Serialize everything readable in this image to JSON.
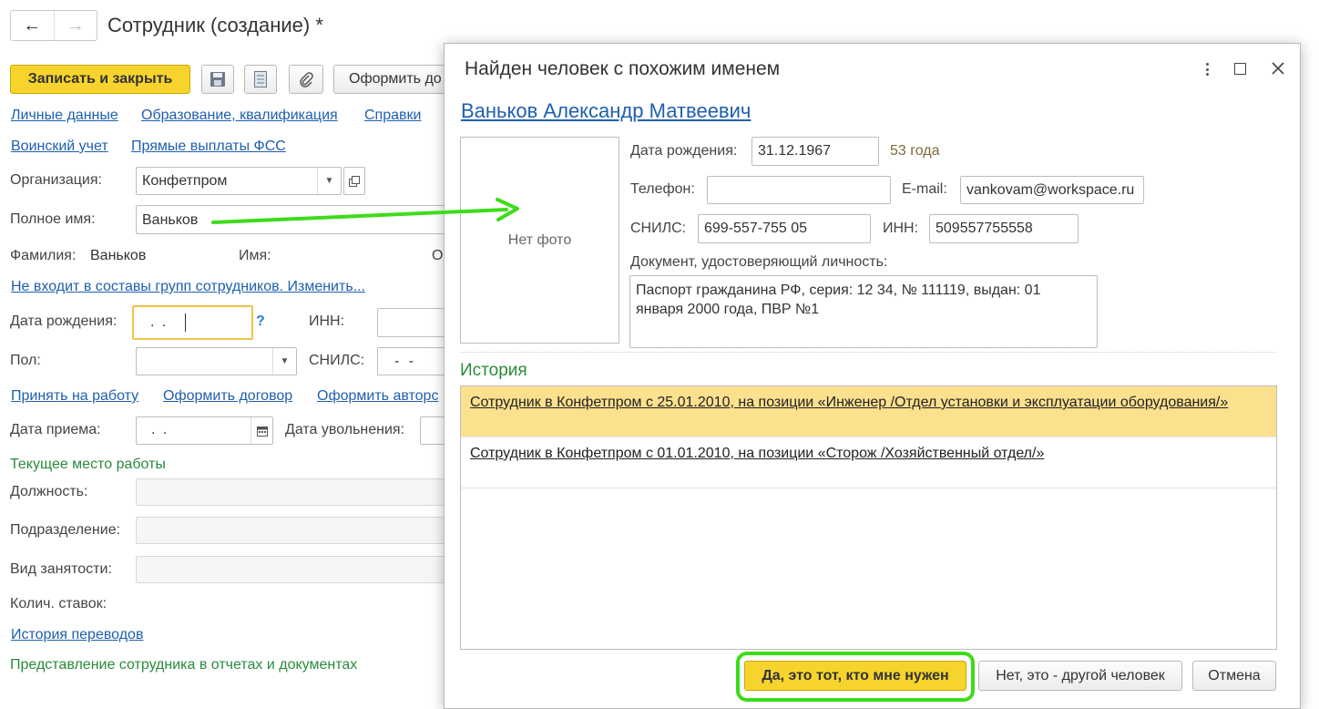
{
  "window": {
    "title": "Сотрудник (создание) *"
  },
  "toolbar": {
    "save_close": "Записать и закрыть",
    "oformit": "Оформить до"
  },
  "links_row1": [
    "Личные данные",
    "Образование, квалификация",
    "Справки"
  ],
  "links_row2": [
    "Воинский учет",
    "Прямые выплаты ФСС"
  ],
  "form": {
    "org_label": "Организация:",
    "org_value": "Конфетпром",
    "fullname_label": "Полное имя:",
    "fullname_value": "Ваньков",
    "surname_label": "Фамилия:",
    "surname_value": "Ваньков",
    "name_label": "Имя:",
    "otch_label": "О",
    "groups_link": "Не входит в составы групп сотрудников. Изменить...",
    "birth_label": "Дата рождения:",
    "birth_value": ".  .",
    "help": "?",
    "inn_label": "ИНН:",
    "sex_label": "Пол:",
    "snils_label": "СНИЛС:",
    "snils_value": "-  -",
    "hire_links": [
      "Принять на работу",
      "Оформить договор",
      "Оформить авторс"
    ],
    "hire_date_label": "Дата приема:",
    "hire_date_value": ".  .",
    "fire_date_label": "Дата увольнения:",
    "current_work": "Текущее место работы",
    "position_label": "Должность:",
    "dept_label": "Подразделение:",
    "employment_label": "Вид занятости:",
    "rates_label": "Колич. ставок:",
    "history_link": "История переводов",
    "presentation": "Представление сотрудника в отчетах и документах"
  },
  "dialog": {
    "title": "Найден человек с похожим именем",
    "person_name": "Ваньков Александр Матвеевич",
    "no_photo": "Нет фото",
    "birth_label": "Дата рождения:",
    "birth_value": "31.12.1967",
    "age": "53 года",
    "phone_label": "Телефон:",
    "phone_value": "",
    "email_label": "E-mail:",
    "email_value": "vankovam@workspace.ru",
    "snils_label": "СНИЛС:",
    "snils_value": "699-557-755 05",
    "inn_label": "ИНН:",
    "inn_value": "509557755558",
    "doc_label": "Документ, удостоверяющий личность:",
    "doc_value": "Паспорт гражданина РФ, серия: 12 34, № 111119, выдан: 01 января 2000 года, ПВР №1",
    "history_title": "История",
    "history": [
      "Сотрудник в Конфетпром с 25.01.2010, на позиции «Инженер /Отдел установки и эксплуатации оборудования/»",
      "Сотрудник в Конфетпром с 01.01.2010, на позиции «Сторож /Хозяйственный отдел/»"
    ],
    "btn_yes": "Да, это тот, кто мне нужен",
    "btn_no": "Нет, это - другой человек",
    "btn_cancel": "Отмена"
  },
  "colors": {
    "accent_yellow": "#f6d42d",
    "highlight_row": "#fbe08e",
    "link_blue": "#1f5fae",
    "section_green": "#2a8b3c",
    "annotation_green": "#3ddc1b"
  }
}
